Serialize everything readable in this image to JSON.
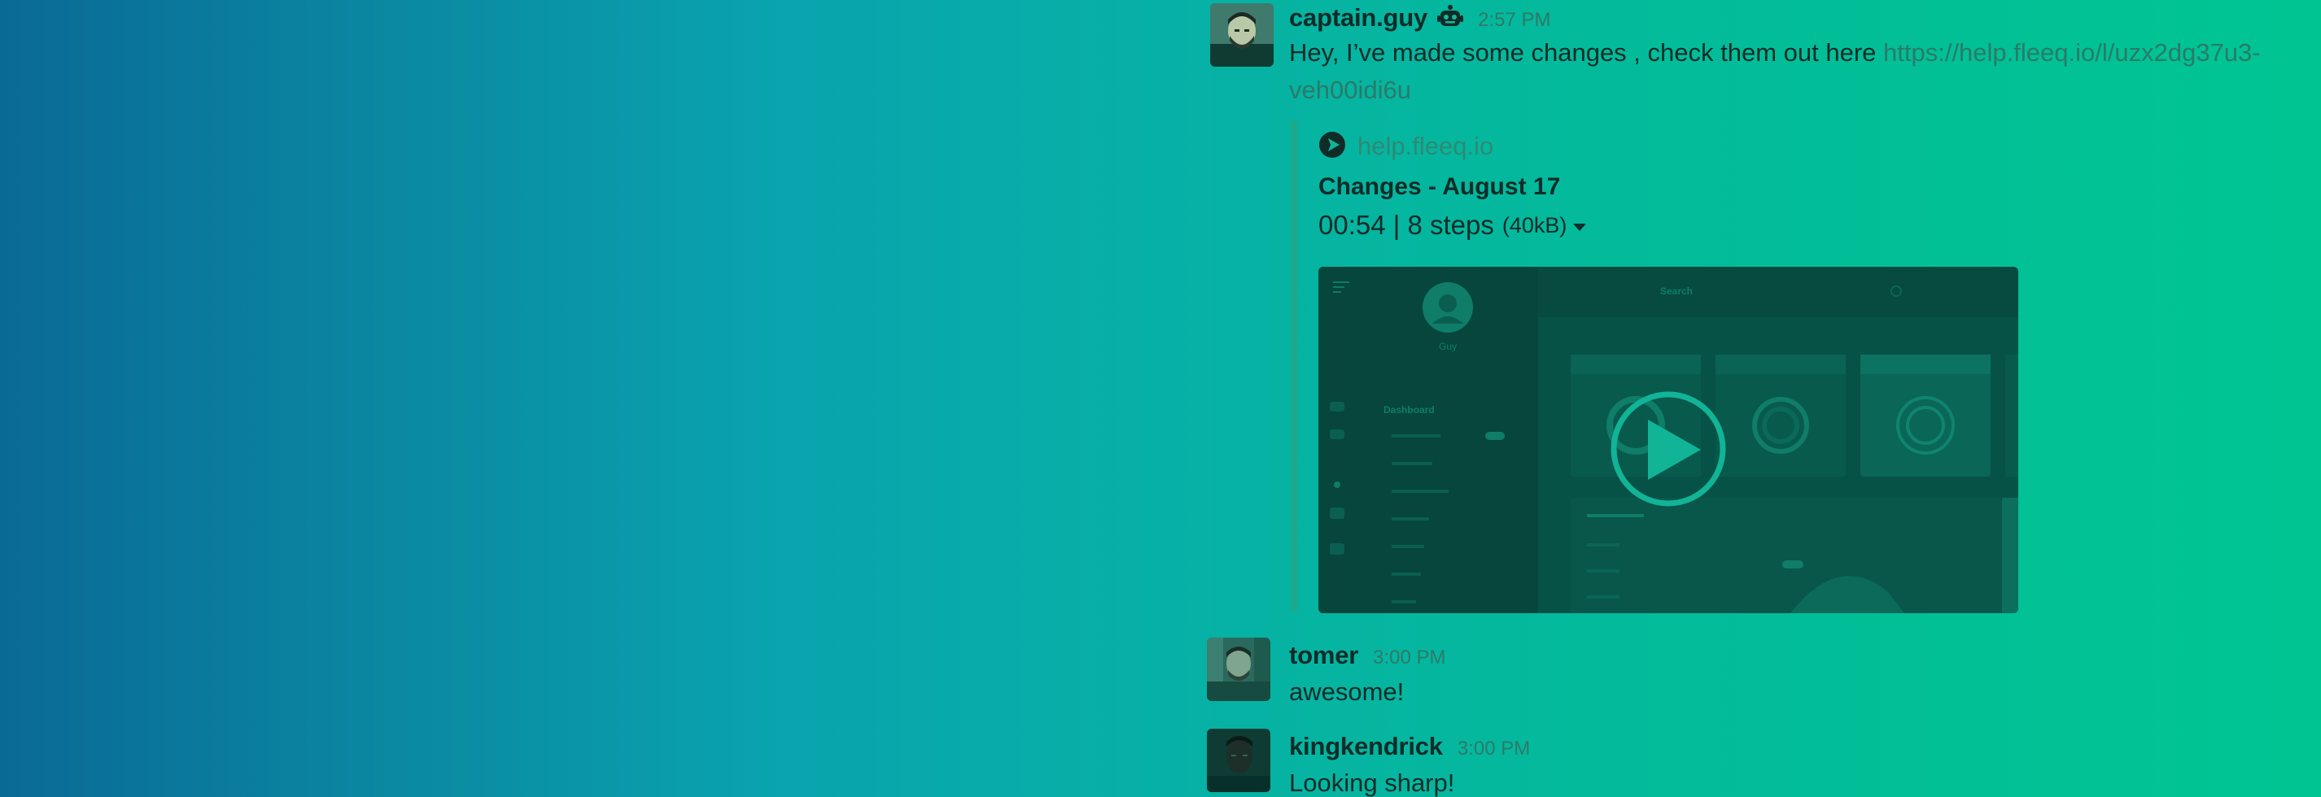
{
  "messages": [
    {
      "author": "captain.guy",
      "time": "2:57 PM",
      "bot_icon": "robot-icon",
      "text": "Hey, I’ve made some changes , check them out here ",
      "link_line1": "https://help.fleeq.io/l/uzx2dg37u3-",
      "link_line2": "veh00idi6u"
    },
    {
      "author": "tomer",
      "time": "3:00 PM",
      "text": "awesome!"
    },
    {
      "author": "kingkendrick",
      "time": "3:00 PM",
      "text": "Looking sharp!"
    }
  ],
  "attachment": {
    "site_icon": "fleeq-play-logo-icon",
    "site": "help.fleeq.io",
    "title": "Changes - August 17",
    "meta": "00:54 | 8 steps",
    "size": "(40kB)",
    "video_preview": {
      "user_name": "Guy",
      "search_label": "Search",
      "menu_heading": "Dashboard",
      "play_icon": "play-circle-icon"
    }
  },
  "colors": {
    "background_start": "#0a6a96",
    "background_end": "#00c592",
    "attachment_border": "#1ea98a",
    "link": "#2a7b68"
  }
}
